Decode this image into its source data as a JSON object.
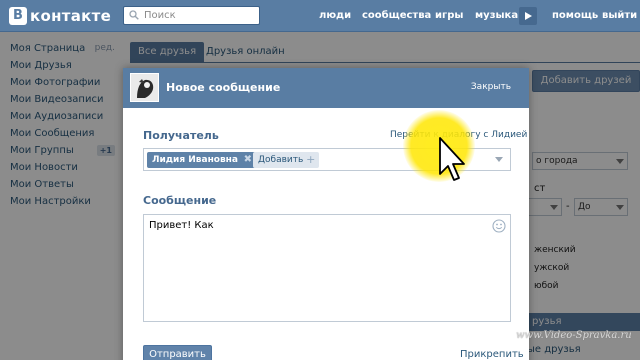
{
  "header": {
    "logo_mark": "B",
    "logo_text": "контакте",
    "search_placeholder": "Поиск",
    "nav": [
      "люди",
      "сообщества",
      "игры",
      "музыка",
      "помощь",
      "выйти"
    ]
  },
  "left_menu": {
    "items": [
      {
        "label": "Моя Страница",
        "edit": "ред."
      },
      {
        "label": "Мои Друзья"
      },
      {
        "label": "Мои Фотографии"
      },
      {
        "label": "Мои Видеозаписи"
      },
      {
        "label": "Мои Аудиозаписи"
      },
      {
        "label": "Мои Сообщения"
      },
      {
        "label": "Мои Группы",
        "count": "+1"
      },
      {
        "label": "Мои Новости"
      },
      {
        "label": "Мои Ответы"
      },
      {
        "label": "Мои Настройки"
      }
    ]
  },
  "page": {
    "tab_active": "Все друзья",
    "tab_other": "Друзья онлайн",
    "add_friends": "Добавить друзей",
    "filter_city": "о города",
    "filter_age_label": "ст",
    "age_to": "До",
    "dash": "-",
    "gender_options": [
      "женский",
      "ужской",
      "юбой"
    ],
    "blue_button": "рузья",
    "bottom_link": "ые друзья"
  },
  "dialog": {
    "title": "Новое сообщение",
    "close": "Закрыть",
    "recipient_label": "Получатель",
    "goto_link": "Перейти к диалогу с Лидией",
    "recipient_chip": "Лидия Ивановна",
    "chip_remove": "✖",
    "add_label": "Добавить",
    "add_plus": "+",
    "message_label": "Сообщение",
    "message_text": "Привет! Как",
    "send": "Отправить",
    "attach": "Прикрепить"
  },
  "watermark": "www.Video-Spravka.ru",
  "colors": {
    "vk_blue": "#597da3",
    "link": "#2b587a",
    "label": "#45688e",
    "highlight": "#ffe600"
  },
  "icons": [
    "search-icon",
    "smile-icon",
    "cursor-icon",
    "dropdown-arrow-icon",
    "play-icon"
  ]
}
